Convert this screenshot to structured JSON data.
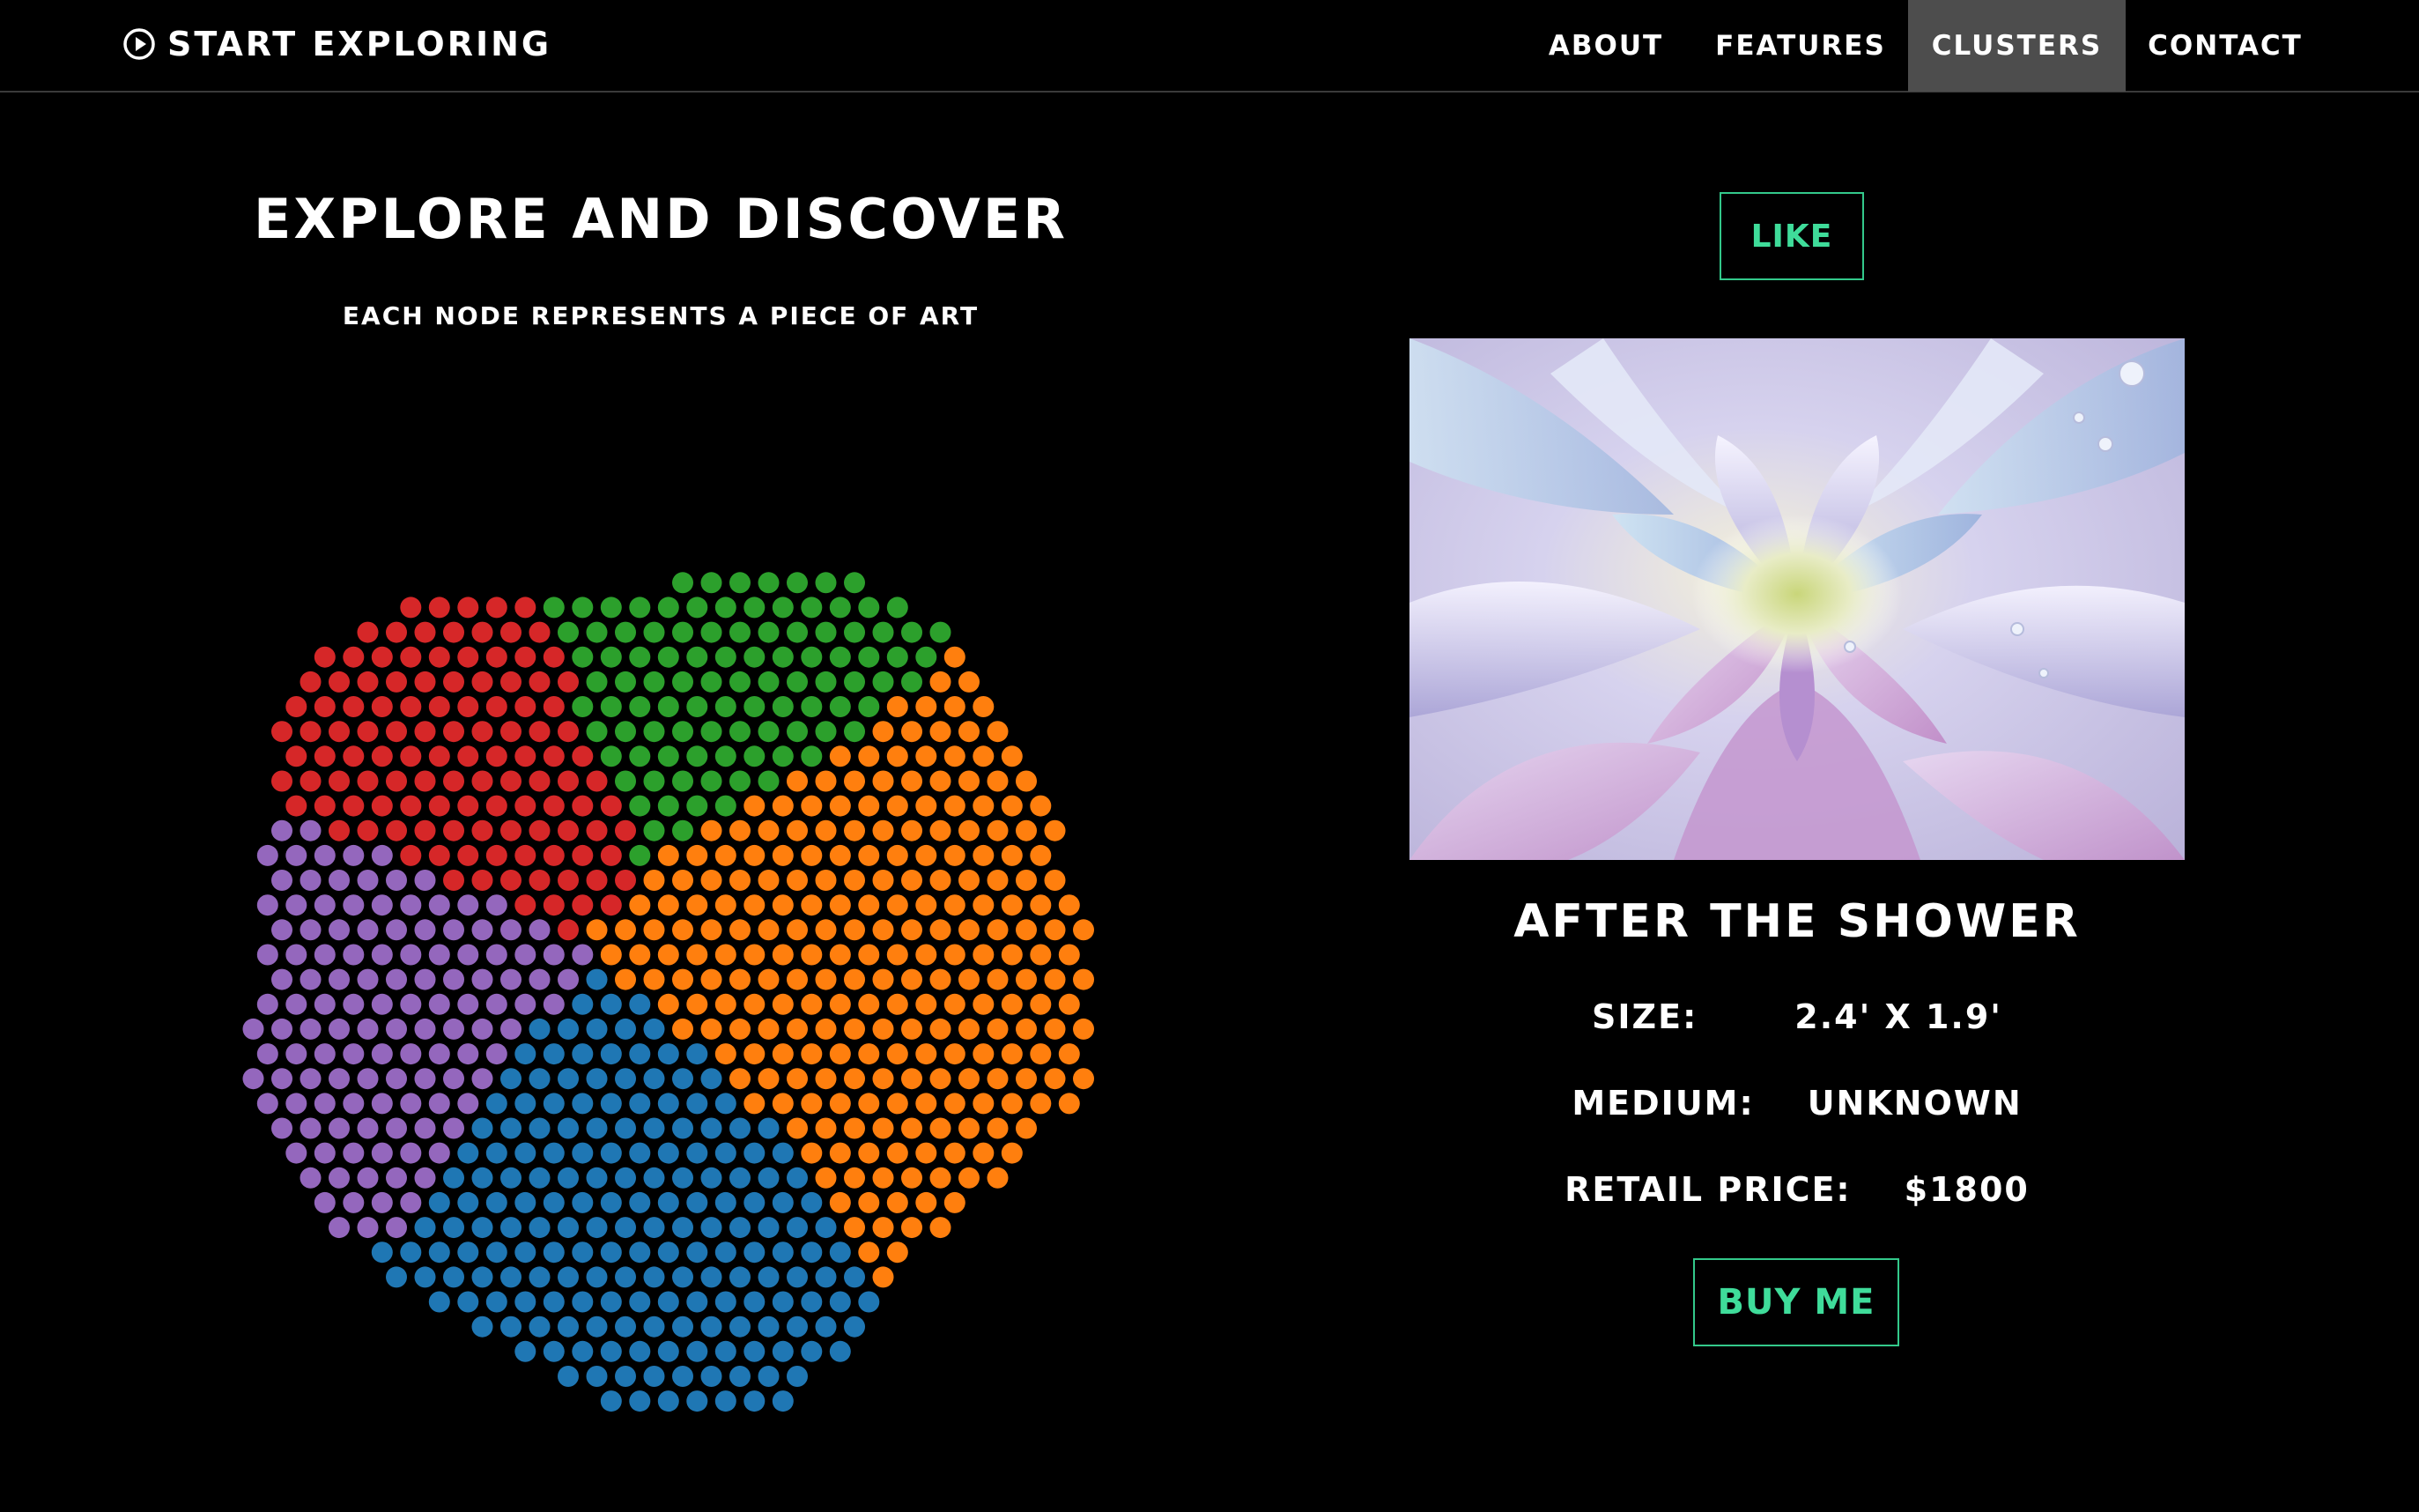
{
  "navbar": {
    "brand_label": "START EXPLORING",
    "brand_icon": "play-circle-icon",
    "items": [
      {
        "label": "ABOUT",
        "active": false
      },
      {
        "label": "FEATURES",
        "active": false
      },
      {
        "label": "CLUSTERS",
        "active": true
      },
      {
        "label": "CONTACT",
        "active": false
      }
    ]
  },
  "hero": {
    "title": "EXPLORE AND DISCOVER",
    "subtitle": "EACH NODE REPRESENTS A PIECE OF ART"
  },
  "clusters": [
    {
      "color": "#2ca02c"
    },
    {
      "color": "#d62728"
    },
    {
      "color": "#ff7f0e"
    },
    {
      "color": "#9467bd"
    },
    {
      "color": "#1f77b4"
    }
  ],
  "artwork": {
    "like_label": "LIKE",
    "image_alt": "Watercolor painting of a pale purple and white dahlia with water droplets",
    "title": "AFTER THE SHOWER",
    "details": [
      {
        "label": "SIZE:",
        "value": "2.4' X 1.9'"
      },
      {
        "label": "MEDIUM:",
        "value": "UNKNOWN"
      },
      {
        "label": "RETAIL PRICE:",
        "value": "$1800"
      }
    ],
    "buy_label": "BUY ME"
  },
  "colors": {
    "background": "#000000",
    "accent": "#3fdc9a",
    "nav_active_bg": "#4d4d4d"
  }
}
